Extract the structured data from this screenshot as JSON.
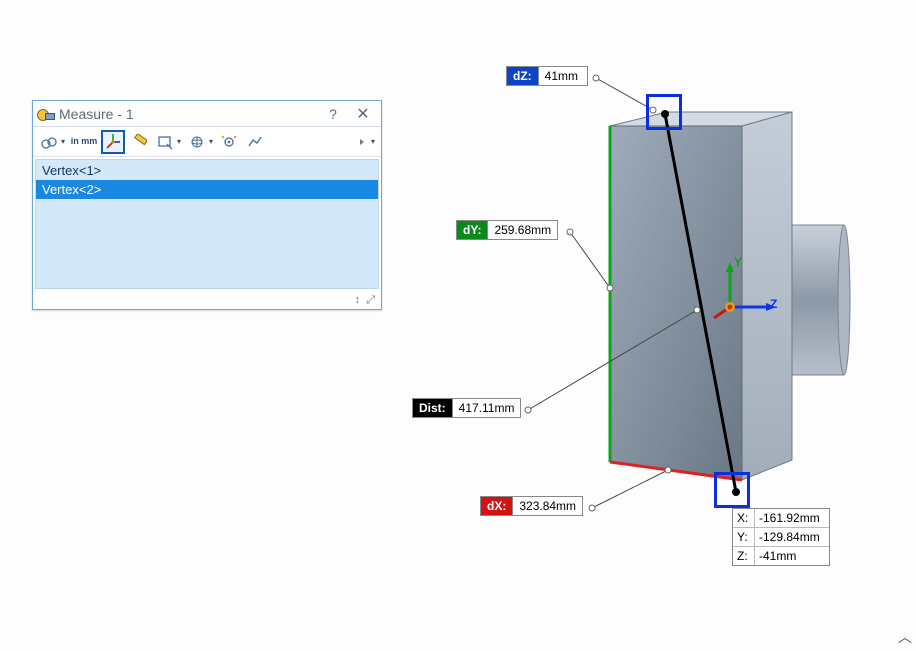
{
  "dialog": {
    "title": "Measure - 1",
    "help_symbol": "?",
    "close_symbol": "✕",
    "toolbar": {
      "arc_btn": "↺↻",
      "units_btn": "in\nmm",
      "xyz_btn": "xyz",
      "ruler_btn": "📏",
      "select_btn": "▭",
      "globe_btn": "🌐",
      "sensor_btn": "👁",
      "history_btn": "📈",
      "pin_symbol": "⊣",
      "active_button": "xyz"
    },
    "list_items": [
      "Vertex<1>",
      "Vertex<2>"
    ],
    "selected_index": 1,
    "status_icons": [
      "↕",
      "⤢"
    ]
  },
  "measurements": {
    "dz": {
      "label": "dZ:",
      "value": "41mm"
    },
    "dy": {
      "label": "dY:",
      "value": "259.68mm"
    },
    "dx": {
      "label": "dX:",
      "value": "323.84mm"
    },
    "dist": {
      "label": "Dist:",
      "value": "417.11mm"
    }
  },
  "coordinates": {
    "x": {
      "label": "X:",
      "value": "-161.92mm"
    },
    "y": {
      "label": "Y:",
      "value": "-129.84mm"
    },
    "z": {
      "label": "Z:",
      "value": "-41mm"
    }
  },
  "triad": {
    "y": "Y",
    "z": "Z"
  },
  "colors": {
    "dz": "#0b44c9",
    "dy": "#0a8a1a",
    "dx": "#d11313",
    "dist": "#000000",
    "selection_blue": "#0b2fe0",
    "edge_green": "#0ca51a",
    "edge_red": "#e02020",
    "part_gray": "#7d8c9c"
  },
  "chart_data": {
    "type": "table",
    "title": "Point-to-point measurement",
    "rows": [
      {
        "metric": "dX",
        "value": 323.84,
        "unit": "mm"
      },
      {
        "metric": "dY",
        "value": 259.68,
        "unit": "mm"
      },
      {
        "metric": "dZ",
        "value": 41,
        "unit": "mm"
      },
      {
        "metric": "Distance",
        "value": 417.11,
        "unit": "mm"
      },
      {
        "metric": "Vertex2 X",
        "value": -161.92,
        "unit": "mm"
      },
      {
        "metric": "Vertex2 Y",
        "value": -129.84,
        "unit": "mm"
      },
      {
        "metric": "Vertex2 Z",
        "value": -41,
        "unit": "mm"
      }
    ]
  }
}
